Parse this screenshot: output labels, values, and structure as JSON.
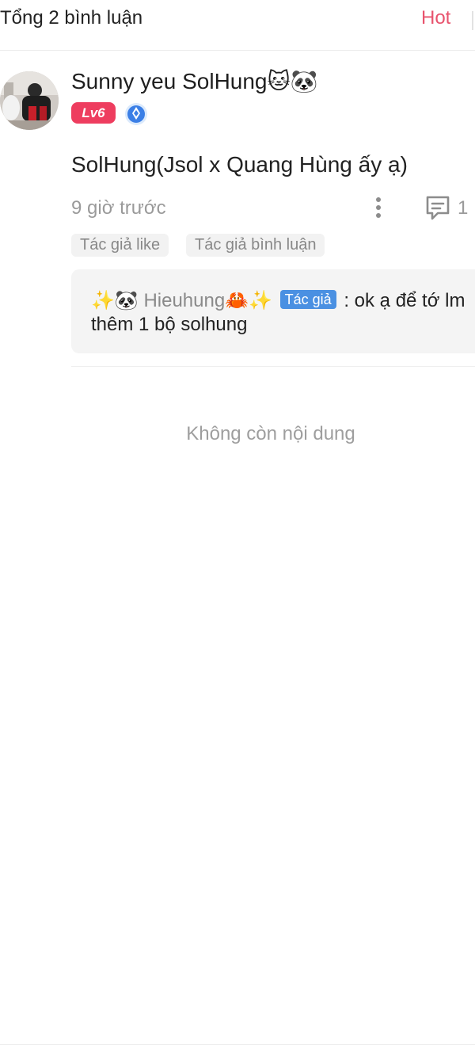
{
  "header": {
    "title": "Tổng 2 bình luận",
    "sort_label": "Hot"
  },
  "comment": {
    "user_name": "Sunny yeu SolHung🐱🐼",
    "level": "Lv6",
    "text": "SolHung(Jsol x Quang Hùng ấy ạ)",
    "time": "9 giờ trước",
    "reply_count": "1",
    "tags": [
      "Tác giả like",
      "Tác giả bình luận"
    ],
    "reply": {
      "prefix": "✨🐼 ",
      "name": "Hieuhung🦀✨",
      "author_badge": "Tác giả",
      "text_line1": ": ok ạ để tớ lm",
      "text_line2": "thêm 1 bộ solhung"
    }
  },
  "footer": {
    "no_more": "Không còn nội dung"
  },
  "colors": {
    "accent": "#e8546e",
    "level_badge": "#ee3d5f",
    "author_badge": "#4a90e2"
  },
  "icons": [
    "more-vertical-icon",
    "comment-icon",
    "medal-icon"
  ]
}
